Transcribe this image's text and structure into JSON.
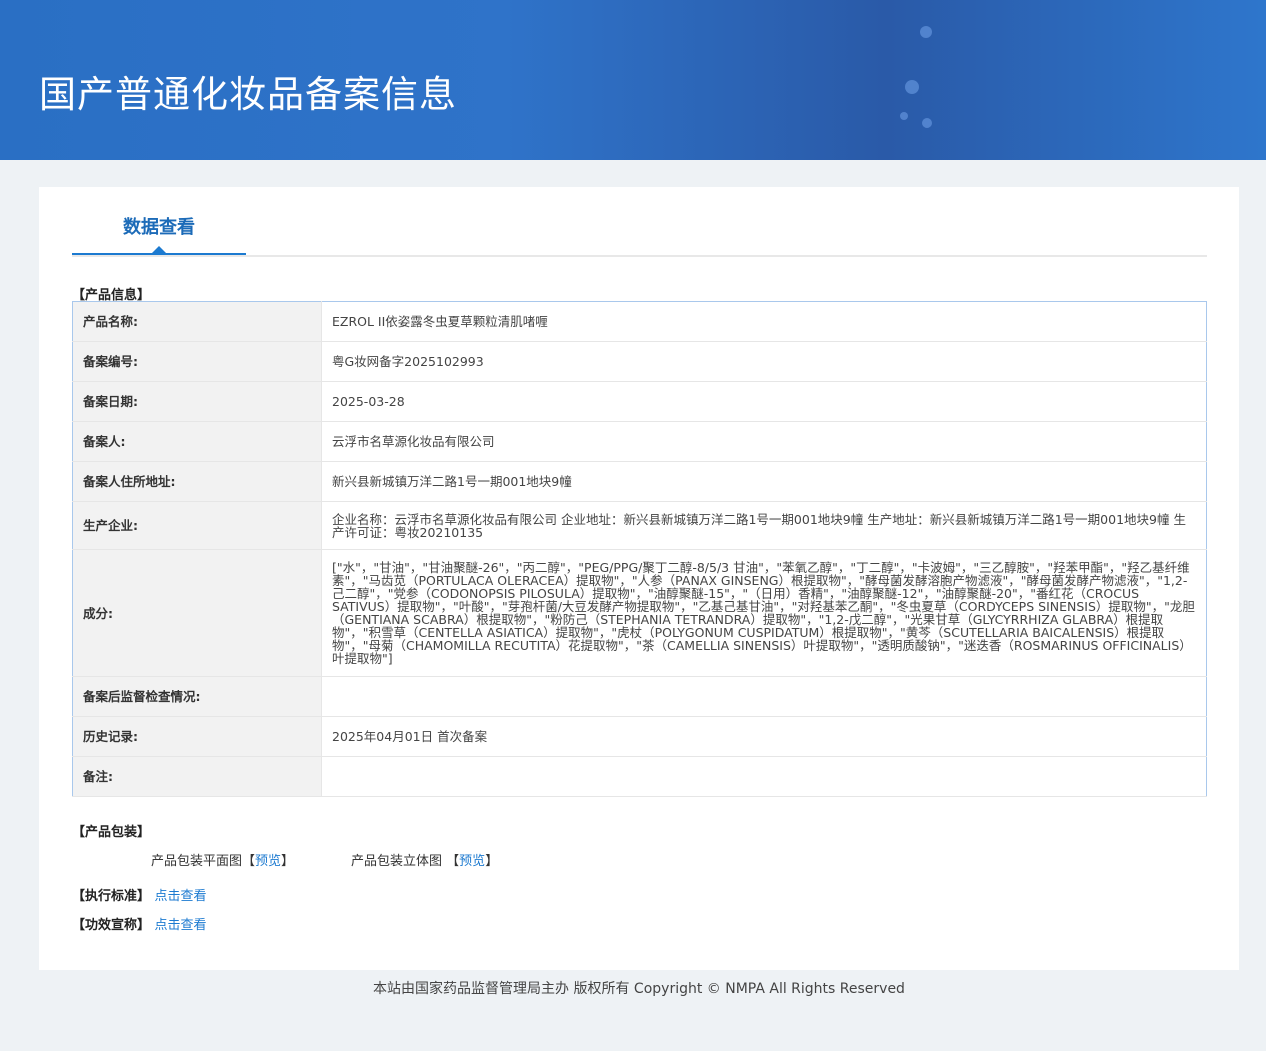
{
  "header": {
    "title": "国产普通化妆品备案信息"
  },
  "tab": {
    "label": "数据查看"
  },
  "sections": {
    "product_info": "【产品信息】",
    "packaging": "【产品包装】",
    "standard": "【执行标准】",
    "efficacy": "【功效宣称】"
  },
  "rows": [
    {
      "label": "产品名称:",
      "value": "EZROL II依姿露冬虫夏草颗粒清肌啫喱"
    },
    {
      "label": "备案编号:",
      "value": "粤G妆网备字2025102993"
    },
    {
      "label": "备案日期:",
      "value": "2025-03-28"
    },
    {
      "label": "备案人:",
      "value": "云浮市名草源化妆品有限公司"
    },
    {
      "label": "备案人住所地址:",
      "value": "新兴县新城镇万洋二路1号一期001地块9幢"
    },
    {
      "label": "生产企业:",
      "value": "企业名称：云浮市名草源化妆品有限公司 企业地址：新兴县新城镇万洋二路1号一期001地块9幢 生产地址：新兴县新城镇万洋二路1号一期001地块9幢 生产许可证：粤妆20210135"
    },
    {
      "label": "成分:",
      "value": "[\"水\"，\"甘油\"，\"甘油聚醚-26\"，\"丙二醇\"，\"PEG/PPG/聚丁二醇-8/5/3 甘油\"，\"苯氧乙醇\"，\"丁二醇\"，\"卡波姆\"，\"三乙醇胺\"，\"羟苯甲酯\"，\"羟乙基纤维素\"，\"马齿苋（PORTULACA OLERACEA）提取物\"，\"人参（PANAX GINSENG）根提取物\"，\"酵母菌发酵溶胞产物滤液\"，\"酵母菌发酵产物滤液\"，\"1,2-己二醇\"，\"党参（CODONOPSIS PILOSULA）提取物\"，\"油醇聚醚-15\"，\"（日用）香精\"，\"油醇聚醚-12\"，\"油醇聚醚-20\"，\"番红花（CROCUS SATIVUS）提取物\"，\"叶酸\"，\"芽孢杆菌/大豆发酵产物提取物\"，\"乙基己基甘油\"，\"对羟基苯乙酮\"，\"冬虫夏草（CORDYCEPS SINENSIS）提取物\"，\"龙胆（GENTIANA SCABRA）根提取物\"，\"粉防己（STEPHANIA TETRANDRA）提取物\"，\"1,2-戊二醇\"，\"光果甘草（GLYCYRRHIZA GLABRA）根提取物\"，\"积雪草（CENTELLA ASIATICA）提取物\"，\"虎杖（POLYGONUM CUSPIDATUM）根提取物\"，\"黄芩（SCUTELLARIA BAICALENSIS）根提取物\"，\"母菊（CHAMOMILLA RECUTITA）花提取物\"，\"茶（CAMELLIA SINENSIS）叶提取物\"，\"透明质酸钠\"，\"迷迭香（ROSMARINUS OFFICINALIS）叶提取物\"]"
    },
    {
      "label": "备案后监督检查情况:",
      "value": ""
    },
    {
      "label": "历史记录:",
      "value": "2025年04月01日 首次备案"
    },
    {
      "label": "备注:",
      "value": ""
    }
  ],
  "packaging": {
    "flat_label": "产品包装平面图",
    "solid_label": "产品包装立体图",
    "preview": "预览",
    "lb": "【",
    "rb": "】"
  },
  "links": {
    "view": "点击查看"
  },
  "footer": {
    "text": "本站由国家药品监督管理局主办 版权所有 Copyright © NMPA All Rights Reserved"
  }
}
